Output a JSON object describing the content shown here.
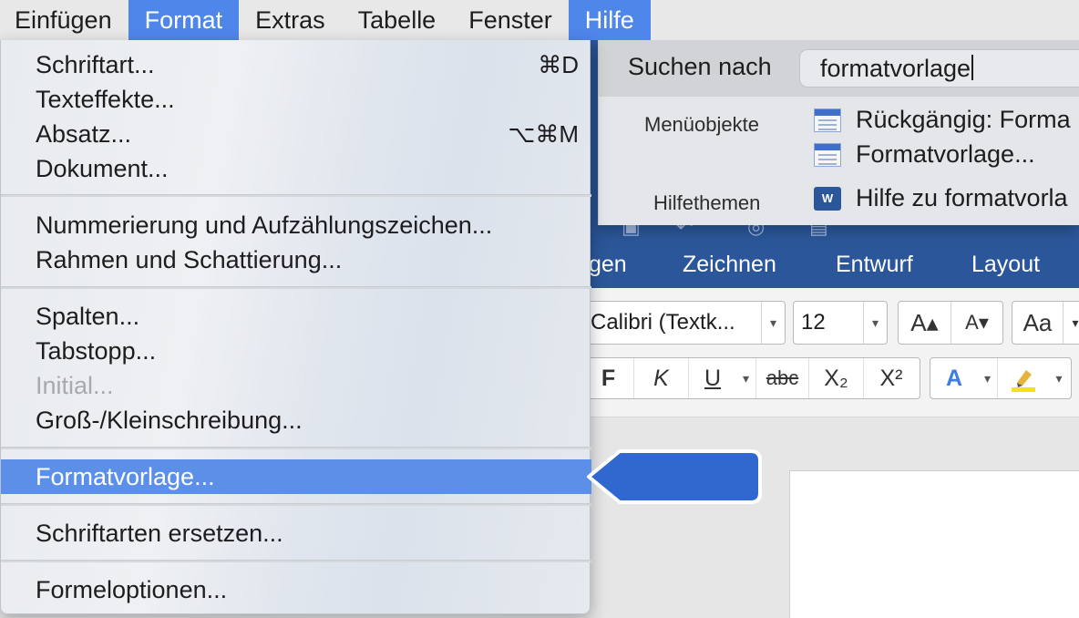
{
  "menubar": {
    "items": [
      "Einfügen",
      "Format",
      "Extras",
      "Tabelle",
      "Fenster",
      "Hilfe"
    ]
  },
  "help": {
    "search_label": "Suchen nach",
    "search_value": "formatvorlage",
    "section_menu": "Menüobjekte",
    "section_help": "Hilfethemen",
    "results": [
      "Rückgängig: Forma",
      "Formatvorlage...",
      "Hilfe zu formatvorla"
    ],
    "word_icon_letter": "W"
  },
  "word": {
    "tabs": [
      "gen",
      "Zeichnen",
      "Entwurf",
      "Layout"
    ],
    "font_name": "Calibri (Textk...",
    "font_size": "12",
    "grow_font": "A▴",
    "shrink_font": "A▾",
    "change_case": "Aa",
    "bold": "F",
    "italic": "K",
    "underline": "U",
    "strike": "abc",
    "subscript": "X₂",
    "superscript": "X²",
    "text_effects": "A",
    "accent_color": "#2b579a"
  },
  "format_menu": {
    "items": [
      {
        "label": "Schriftart...",
        "shortcut": "⌘D"
      },
      {
        "label": "Texteffekte...",
        "shortcut": ""
      },
      {
        "label": "Absatz...",
        "shortcut": "⌥⌘M"
      },
      {
        "label": "Dokument...",
        "shortcut": ""
      },
      {
        "label": "Nummerierung und Aufzählungszeichen...",
        "shortcut": ""
      },
      {
        "label": "Rahmen und Schattierung...",
        "shortcut": ""
      },
      {
        "label": "Spalten...",
        "shortcut": ""
      },
      {
        "label": "Tabstopp...",
        "shortcut": ""
      },
      {
        "label": "Initial...",
        "shortcut": "",
        "disabled": true
      },
      {
        "label": "Groß-/Kleinschreibung...",
        "shortcut": ""
      },
      {
        "label": "Formatvorlage...",
        "shortcut": "",
        "selected": true
      },
      {
        "label": "Schriftarten ersetzen...",
        "shortcut": ""
      },
      {
        "label": "Formeloptionen...",
        "shortcut": ""
      }
    ],
    "highlight_color": "#5b8fe8"
  },
  "callout_color": "#3068d0"
}
